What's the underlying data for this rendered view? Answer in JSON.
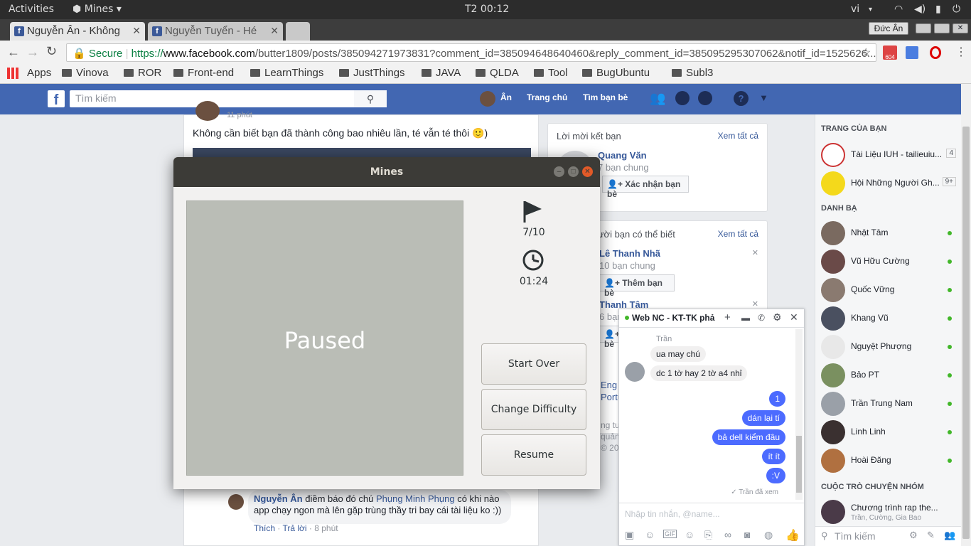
{
  "system": {
    "activities": "Activities",
    "app": "Mines",
    "clock": "T2 00:12",
    "lang": "vi"
  },
  "tabs": [
    {
      "label": "Nguyễn Ân - Không"
    },
    {
      "label": "Nguyễn Tuyển - Hé"
    }
  ],
  "window_user": "Đức Ân",
  "url": {
    "secure": "Secure",
    "prefix": "https://",
    "host": "www.facebook.com",
    "path": "/butter1809/posts/385094271973831?comment_id=385094648640460&reply_comment_id=385095295307062&notif_id=1525626..."
  },
  "ext_badge": "604",
  "bookmarks": [
    "Apps",
    "Vinova",
    "ROR",
    "Front-end",
    "LearnThings",
    "JustThings",
    "JAVA",
    "QLDA",
    "Tool",
    "BugUbuntu",
    "Subl3"
  ],
  "fb": {
    "search_placeholder": "Tìm kiếm",
    "user": "Ân",
    "home": "Trang chủ",
    "find_friends": "Tìm bạn bè"
  },
  "post": {
    "time": "11 phút",
    "text": "Không cần biết bạn đã thành công bao nhiêu lần, té vẫn té thôi 🙂)"
  },
  "comment": {
    "author": "Nguyễn Ân",
    "text1": " điềm báo đó chú ",
    "mention": "Phụng Minh Phụng",
    "text2": " có khi nào",
    "text3": "app chạy ngon mà lên gặp trùng thầy tri bay cái tài liệu ko :))",
    "like": "Thích",
    "reply": "Trả lời",
    "time": "8 phút"
  },
  "friend_requests": {
    "title": "Lời mời kết bạn",
    "see_all": "Xem tất cả",
    "name": "Quang Văn",
    "mutual": "7 bạn chung",
    "confirm": "Xác nhận bạn bè"
  },
  "pymk": {
    "title": "Những người bạn có thể biết",
    "see_all": "Xem tất cả",
    "people": [
      {
        "name": "Lê Thanh Nhã",
        "mutual": "10 bạn chung",
        "add": "Thêm bạn bè"
      },
      {
        "name": "Thanh Tâm",
        "mutual": "6 bạn chung",
        "add": "Thêm bạn bè"
      }
    ]
  },
  "footer": {
    "lang1": "Eng",
    "lang2": "Portu",
    "line1": "ng tư",
    "line2": "quản",
    "line3": "© 20"
  },
  "pages": {
    "title": "TRANG CỦA BẠN",
    "items": [
      {
        "name": "Tài Liệu IUH - tailieuiu...",
        "count": "4"
      },
      {
        "name": "Hội Những Người Gh...",
        "count": "9+"
      }
    ]
  },
  "contacts": {
    "title": "DANH BẠ",
    "items": [
      "Nhật Tâm",
      "Vũ Hữu Cường",
      "Quốc Vững",
      "Khang Vũ",
      "Nguyệt Phượng",
      "Bảo PT",
      "Trần Trung Nam",
      "Linh Linh",
      "Hoài Đăng"
    ]
  },
  "group_chats": {
    "title": "CUỘC TRÒ CHUYỆN NHÓM",
    "name": "Chương trình rap the...",
    "members": "Trần, Cường, Gia Bao"
  },
  "sidebar_search": "Tìm kiếm",
  "chat": {
    "title": "Web NC - KT-TK phả",
    "sender": "Trần",
    "in_messages": [
      "ua may chú",
      "dc 1 tờ hay 2 tờ a4 nhỉ"
    ],
    "out_messages": [
      "1",
      "dán lại tí",
      "bả dell kiểm đâu",
      "ít ít",
      ":V"
    ],
    "seen": "✓ Trần đã xem",
    "input_placeholder": "Nhập tin nhắn, @name..."
  },
  "mines": {
    "title": "Mines",
    "flags": "7/10",
    "time": "01:24",
    "paused": "Paused",
    "start_over": "Start Over",
    "change_difficulty": "Change Difficulty",
    "resume": "Resume"
  },
  "colors": {
    "fb_blue": "#4267b2",
    "board": "#babdb6",
    "titlebar": "#3c3b37",
    "messenger": "#4c6bff"
  }
}
